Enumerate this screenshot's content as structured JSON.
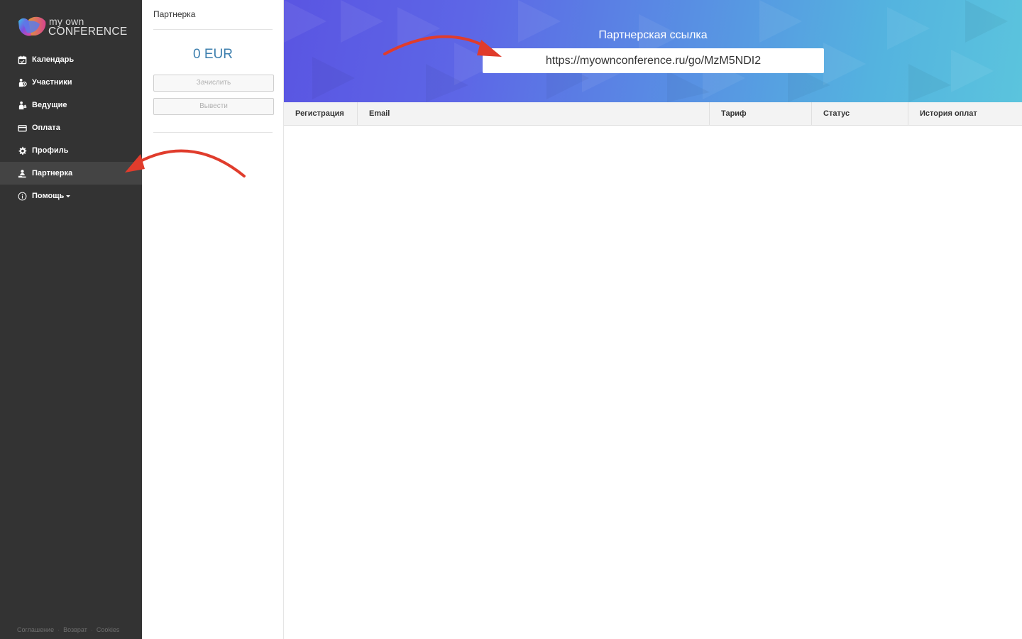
{
  "app": {
    "logo_small": "my own",
    "logo_big": "CONFERENCE"
  },
  "sidebar": {
    "items": [
      {
        "label": "Календарь",
        "icon": "calendar-icon"
      },
      {
        "label": "Участники",
        "icon": "participants-icon"
      },
      {
        "label": "Ведущие",
        "icon": "microphone-icon"
      },
      {
        "label": "Оплата",
        "icon": "credit-card-icon"
      },
      {
        "label": "Профиль",
        "icon": "gear-icon"
      },
      {
        "label": "Партнерка",
        "icon": "partner-icon",
        "active": true
      },
      {
        "label": "Помощь",
        "icon": "info-icon",
        "has_dropdown": true
      }
    ],
    "footer": [
      "Соглашение",
      "Возврат",
      "Cookies"
    ]
  },
  "partner_panel": {
    "title": "Партнерка",
    "balance": "0 EUR",
    "credit_button": "Зачислить",
    "withdraw_button": "Вывести"
  },
  "banner": {
    "title": "Партнерская ссылка",
    "link": "https://myownconference.ru/go/MzM5NDI2"
  },
  "table": {
    "columns": [
      "Регистрация",
      "Email",
      "Тариф",
      "Статус",
      "История оплат"
    ]
  },
  "colors": {
    "sidebar_bg": "#333333",
    "accent_blue": "#3d7fae",
    "arrow_red": "#e03c2c"
  }
}
